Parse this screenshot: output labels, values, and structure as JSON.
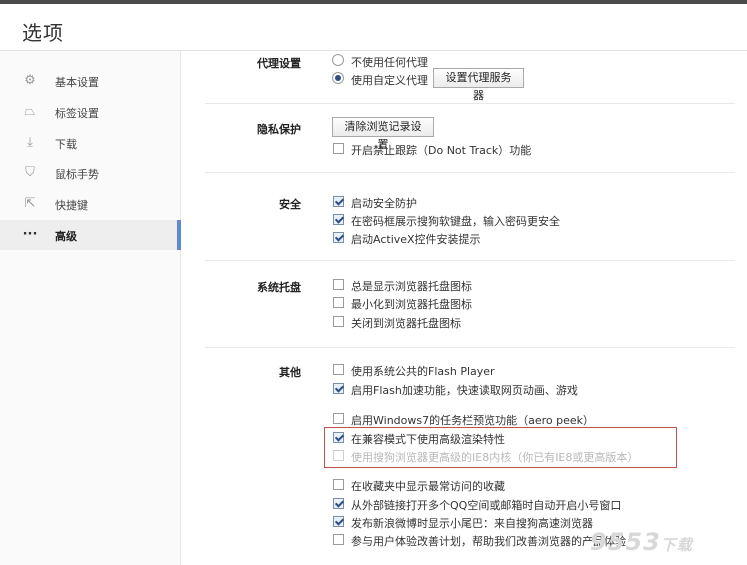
{
  "window": {
    "title": "选项"
  },
  "sidebar": {
    "items": [
      {
        "label": "基本设置",
        "icon": "gear-icon"
      },
      {
        "label": "标签设置",
        "icon": "tab-icon"
      },
      {
        "label": "下载",
        "icon": "download-icon"
      },
      {
        "label": "鼠标手势",
        "icon": "mouse-icon"
      },
      {
        "label": "快捷键",
        "icon": "shortcut-icon"
      },
      {
        "label": "高级",
        "icon": "more-icon",
        "active": true
      }
    ]
  },
  "sections": {
    "proxy": {
      "label": "代理设置",
      "options": [
        {
          "label": "不使用任何代理",
          "selected": false
        },
        {
          "label": "使用自定义代理",
          "selected": true
        }
      ],
      "button": "设置代理服务器"
    },
    "privacy": {
      "label": "隐私保护",
      "button": "清除浏览记录设置",
      "options": [
        {
          "label": "开启禁止跟踪（Do Not Track）功能",
          "checked": false
        }
      ]
    },
    "security": {
      "label": "安全",
      "options": [
        {
          "label": "启动安全防护",
          "checked": true
        },
        {
          "label": "在密码框展示搜狗软键盘，输入密码更安全",
          "checked": true
        },
        {
          "label": "启动ActiveX控件安装提示",
          "checked": true
        }
      ]
    },
    "tray": {
      "label": "系统托盘",
      "options": [
        {
          "label": "总是显示浏览器托盘图标",
          "checked": false
        },
        {
          "label": "最小化到浏览器托盘图标",
          "checked": false
        },
        {
          "label": "关闭到浏览器托盘图标",
          "checked": false
        }
      ]
    },
    "other": {
      "label": "其他",
      "options": [
        {
          "label": "使用系统公共的Flash Player",
          "checked": false
        },
        {
          "label": "启用Flash加速功能，快速读取网页动画、游戏",
          "checked": true
        },
        {
          "label": "启用Windows7的任务栏预览功能（aero peek）",
          "checked": false
        },
        {
          "label": "在兼容模式下使用高级渲染特性",
          "checked": true
        },
        {
          "label": "使用搜狗浏览器更高级的IE8内核（你已有IE8或更高版本）",
          "checked": false,
          "disabled": true
        },
        {
          "label": "在收藏夹中显示最常访问的收藏",
          "checked": false
        },
        {
          "label": "从外部链接打开多个QQ空间或邮箱时自动开启小号窗口",
          "checked": true
        },
        {
          "label": "发布新浪微博时显示小尾巴：来自搜狗高速浏览器",
          "checked": true
        },
        {
          "label": "参与用户体验改善计划，帮助我们改善浏览器的产品体验",
          "checked": false
        }
      ]
    }
  },
  "watermark": {
    "main": "9553",
    "suffix": "下载"
  }
}
